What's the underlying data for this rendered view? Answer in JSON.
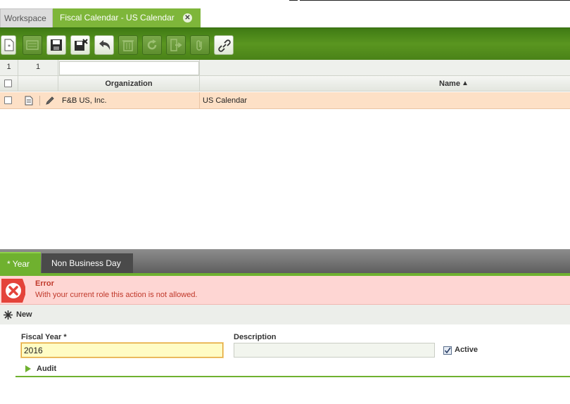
{
  "tabs": {
    "workspace": "Workspace",
    "active": "Fiscal Calendar - US Calendar",
    "close_glyph": "✕"
  },
  "toolbar": {
    "buttons": [
      {
        "name": "new-document-icon",
        "enabled": true
      },
      {
        "name": "form-view-icon",
        "enabled": false
      },
      {
        "name": "save-icon",
        "enabled": true
      },
      {
        "name": "save-close-icon",
        "enabled": true
      },
      {
        "name": "undo-icon",
        "enabled": true
      },
      {
        "name": "delete-icon",
        "enabled": false
      },
      {
        "name": "refresh-icon",
        "enabled": false
      },
      {
        "name": "export-icon",
        "enabled": false
      },
      {
        "name": "attachment-icon",
        "enabled": false
      },
      {
        "name": "link-icon",
        "enabled": true
      }
    ]
  },
  "grid": {
    "row_count": "1",
    "selected_count": "1",
    "filter_value": "",
    "columns": {
      "organization": "Organization",
      "name": "Name",
      "sort_glyph": "▲"
    },
    "rows": [
      {
        "organization": "F&B US, Inc.",
        "name": "US Calendar"
      }
    ]
  },
  "subtabs": {
    "year": "* Year",
    "non_business_day": "Non Business Day"
  },
  "error": {
    "title": "Error",
    "message": "With your current role this action is not allowed."
  },
  "newbar": {
    "label": "New"
  },
  "form": {
    "fiscal_year_label": "Fiscal Year *",
    "fiscal_year_value": "2016",
    "description_label": "Description",
    "description_value": "",
    "active_label": "Active",
    "active_checked": true,
    "audit_label": "Audit"
  },
  "colors": {
    "accent_green": "#6fb12f",
    "toolbar_green": "#4a8218",
    "selected_row": "#fde0c6",
    "error_bg": "#fed6d3",
    "error_text": "#c0392b"
  }
}
